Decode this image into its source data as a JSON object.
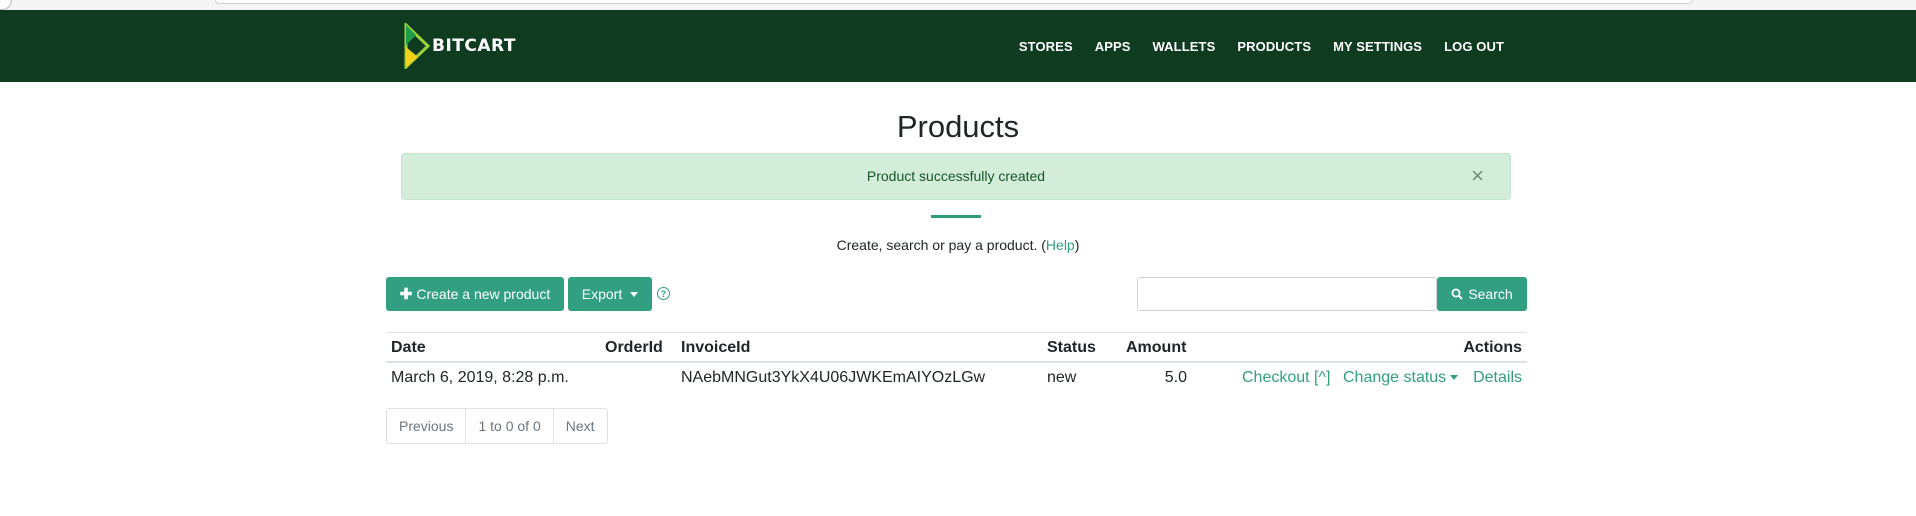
{
  "brand": {
    "name": "BITCART"
  },
  "nav": {
    "items": [
      "STORES",
      "APPS",
      "WALLETS",
      "PRODUCTS",
      "MY SETTINGS",
      "LOG OUT"
    ]
  },
  "page": {
    "title": "Products",
    "alert": "Product successfully created",
    "alert_close": "×",
    "lead_text": "Create, search or pay a product. (",
    "lead_link": "Help",
    "lead_end": ")"
  },
  "toolbar": {
    "create_label": "Create a new product",
    "export_label": "Export",
    "help_icon": "?",
    "search_placeholder": "",
    "search_label": "Search"
  },
  "table": {
    "headers": [
      "Date",
      "OrderId",
      "InvoiceId",
      "Status",
      "Amount",
      "Actions"
    ],
    "rows": [
      {
        "date": "March 6, 2019, 8:28 p.m.",
        "order_id": "",
        "invoice_id": "NAebMNGut3YkX4U06JWKEmAIYOzLGw",
        "status": "new",
        "amount": "5.0",
        "actions": {
          "checkout": "Checkout [^]",
          "change_status": "Change status",
          "details": "Details"
        }
      }
    ]
  },
  "pagination": {
    "previous": "Previous",
    "range": "1 to 0 of 0",
    "next": "Next"
  },
  "colors": {
    "navbar": "#0f3b21",
    "accent": "#329f80",
    "alert_bg": "#d4eddb",
    "alert_text": "#155724"
  }
}
